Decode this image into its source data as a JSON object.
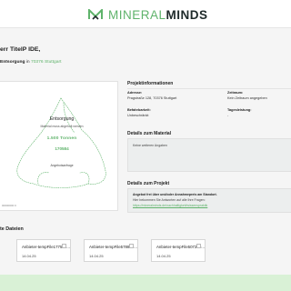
{
  "brand": {
    "part1": "MINERAL",
    "part2": "MINDS",
    "accent": "#5fb36b",
    "dark": "#1e2a2a"
  },
  "greeting": "err TitelP IDE,",
  "address": {
    "bold": "Entsorgung",
    "middle": " in ",
    "city": "70376 Stuttgart"
  },
  "card": {
    "title": "Entsorgung",
    "subtitle": "Material muss abgeholt werden",
    "quantity": "1.500 Tonnen",
    "number": "170584",
    "button": "Angebotsanfrage",
    "id": "00000000 0"
  },
  "projekt": {
    "title": "Projektinformationen",
    "adresse_label": "Adresse:",
    "adresse_value": "Pragstraße 128, 70376 Stuttgart",
    "zeitraum_label": "Zeitraum:",
    "zeitraum_value": "Kein Zeitraum angegeben",
    "befahrbarkeit_label": "Befahrbarkeit:",
    "befahrbarkeit_value": "Unbeschränkt",
    "tagesleistung_label": "Tagesleistung:",
    "tagesleistung_value": "-"
  },
  "material": {
    "title": "Details zum Material",
    "text": "Keine weiteren Angaben"
  },
  "projektdetails": {
    "title": "Details zum Projekt",
    "line1": "Angebot frei über und/oder Annahmepreis am Standort.",
    "line2": "Hier bekommen Sie Antworten auf alle Ihre Fragen:",
    "link": "https://mineralminds.de/nachhaltigkeit/wissenspraktik"
  },
  "files": {
    "title": "te Dateien",
    "items": [
      {
        "name": "Anbieter-tempFile177506...",
        "date": "14.04.25"
      },
      {
        "name": "Anbieter-tempFile578889...",
        "date": "14.04.25"
      },
      {
        "name": "Anbieter-tempFile507240...",
        "date": "14.04.25"
      }
    ]
  }
}
